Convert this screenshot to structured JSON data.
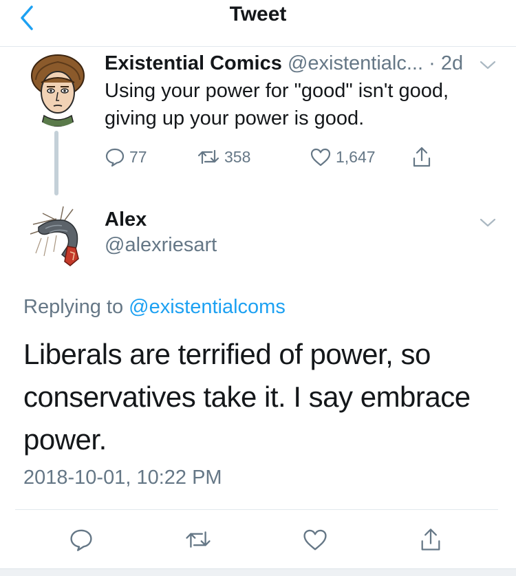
{
  "colors": {
    "accent": "#1da1f2",
    "secondary_text": "#657786",
    "primary_text": "#14171a",
    "divider": "#e1e8ed"
  },
  "nav": {
    "title": "Tweet",
    "back_icon": "chevron-left-icon"
  },
  "parent_tweet": {
    "name": "Existential Comics",
    "handle": "@existentialc...",
    "time_separator": "·",
    "time": "2d",
    "text": "Using your power for \"good\" isn't good, giving up your power is good.",
    "replies": "77",
    "retweets": "358",
    "likes": "1,647"
  },
  "reply_tweet": {
    "name": "Alex",
    "handle": "@alexriesart",
    "replying_prefix": "Replying to",
    "replying_to": "@existentialcoms",
    "text": "Liberals are terrified of power, so conservatives take it. I say embrace power.",
    "timestamp": "2018-10-01, 10:22 PM"
  },
  "action_icons": [
    "reply-icon",
    "retweet-icon",
    "like-icon",
    "share-icon"
  ]
}
